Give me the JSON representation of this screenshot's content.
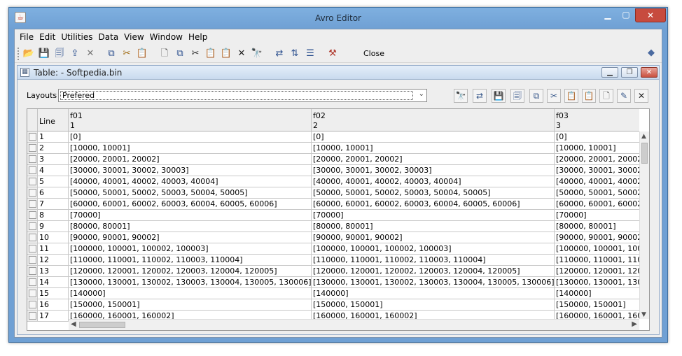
{
  "window": {
    "title": "Avro Editor"
  },
  "menu": [
    "File",
    "Edit",
    "Utilities",
    "Data",
    "View",
    "Window",
    "Help"
  ],
  "toolbar": {
    "close_label": "Close",
    "icons": [
      "open-icon",
      "save-icon",
      "save-as-icon",
      "export-icon",
      "delete-icon",
      "copy-icon",
      "paste-icon",
      "new-icon",
      "copy-icon",
      "cut-icon",
      "paste-icon",
      "paste-special-icon",
      "remove-icon",
      "find-icon",
      "move-icon",
      "sort-icon",
      "table-icon",
      "tools-icon"
    ]
  },
  "internal_frame": {
    "title": "Table: - Softpedia.bin"
  },
  "layouts": {
    "label": "Layouts",
    "selected": "Prefered"
  },
  "table": {
    "columns": [
      {
        "name": "Line",
        "index": ""
      },
      {
        "name": "f01",
        "index": "1"
      },
      {
        "name": "f02",
        "index": "2"
      },
      {
        "name": "f03",
        "index": "3"
      }
    ],
    "rows": [
      {
        "line": "1",
        "f01": "[0]",
        "f02": "[0]",
        "f03": "[0]"
      },
      {
        "line": "2",
        "f01": "[10000, 10001]",
        "f02": "[10000, 10001]",
        "f03": "[10000, 10001]"
      },
      {
        "line": "3",
        "f01": "[20000, 20001, 20002]",
        "f02": "[20000, 20001, 20002]",
        "f03": "[20000, 20001, 20002]"
      },
      {
        "line": "4",
        "f01": "[30000, 30001, 30002, 30003]",
        "f02": "[30000, 30001, 30002, 30003]",
        "f03": "[30000, 30001, 30002, 3"
      },
      {
        "line": "5",
        "f01": "[40000, 40001, 40002, 40003, 40004]",
        "f02": "[40000, 40001, 40002, 40003, 40004]",
        "f03": "[40000, 40001, 40002, 4"
      },
      {
        "line": "6",
        "f01": "[50000, 50001, 50002, 50003, 50004, 50005]",
        "f02": "[50000, 50001, 50002, 50003, 50004, 50005]",
        "f03": "[50000, 50001, 50002, 5"
      },
      {
        "line": "7",
        "f01": "[60000, 60001, 60002, 60003, 60004, 60005, 60006]",
        "f02": "[60000, 60001, 60002, 60003, 60004, 60005, 60006]",
        "f03": "[60000, 60001, 60002, 6"
      },
      {
        "line": "8",
        "f01": "[70000]",
        "f02": "[70000]",
        "f03": "[70000]"
      },
      {
        "line": "9",
        "f01": "[80000, 80001]",
        "f02": "[80000, 80001]",
        "f03": "[80000, 80001]"
      },
      {
        "line": "10",
        "f01": "[90000, 90001, 90002]",
        "f02": "[90000, 90001, 90002]",
        "f03": "[90000, 90001, 90002]"
      },
      {
        "line": "11",
        "f01": "[100000, 100001, 100002, 100003]",
        "f02": "[100000, 100001, 100002, 100003]",
        "f03": "[100000, 100001, 10000"
      },
      {
        "line": "12",
        "f01": "[110000, 110001, 110002, 110003, 110004]",
        "f02": "[110000, 110001, 110002, 110003, 110004]",
        "f03": "[110000, 110001, 11000"
      },
      {
        "line": "13",
        "f01": "[120000, 120001, 120002, 120003, 120004, 120005]",
        "f02": "[120000, 120001, 120002, 120003, 120004, 120005]",
        "f03": "[120000, 120001, 12000"
      },
      {
        "line": "14",
        "f01": "[130000, 130001, 130002, 130003, 130004, 130005, 130006]",
        "f02": "[130000, 130001, 130002, 130003, 130004, 130005, 130006]",
        "f03": "[130000, 130001, 13000"
      },
      {
        "line": "15",
        "f01": "[140000]",
        "f02": "[140000]",
        "f03": "[140000]"
      },
      {
        "line": "16",
        "f01": "[150000, 150001]",
        "f02": "[150000, 150001]",
        "f03": "[150000, 150001]"
      },
      {
        "line": "17",
        "f01": "[160000, 160001, 160002]",
        "f02": "[160000, 160001, 160002]",
        "f03": "[160000, 160001, 16000"
      }
    ]
  }
}
